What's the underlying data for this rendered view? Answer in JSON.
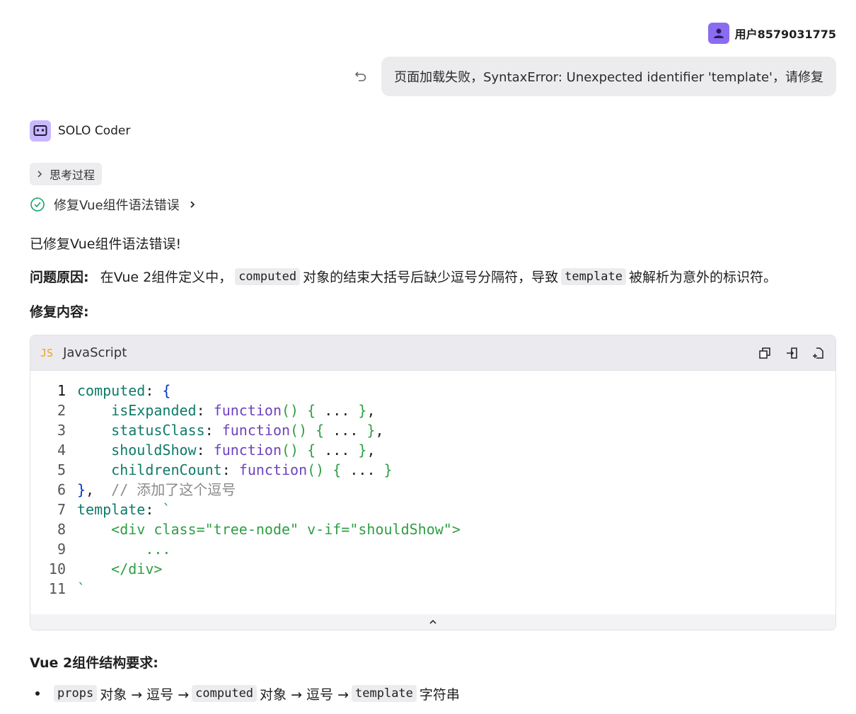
{
  "user": {
    "name": "用户8579031775",
    "message": "页面加载失败，SyntaxError: Unexpected identifier 'template'，请修复"
  },
  "agent": {
    "name": "SOLO Coder"
  },
  "thinking": {
    "label": "思考过程"
  },
  "task": {
    "label": "修复Vue组件语法错误"
  },
  "content": {
    "fixed": "已修复Vue组件语法错误!",
    "cause_label": "问题原因:",
    "cause_pre": "在Vue 2组件定义中，",
    "cause_code1": "computed",
    "cause_mid": "对象的结束大括号后缺少逗号分隔符，导致",
    "cause_code2": "template",
    "cause_post": "被解析为意外的标识符。",
    "fix_heading": "修复内容:",
    "structure_heading": "Vue 2组件结构要求:",
    "bullet_code1": "props",
    "bullet_t1": "对象 → 逗号 →",
    "bullet_code2": "computed",
    "bullet_t2": "对象 → 逗号 →",
    "bullet_code3": "template",
    "bullet_t3": "字符串"
  },
  "code": {
    "badge": "JS",
    "language": "JavaScript",
    "line_numbers": [
      "1",
      "2",
      "3",
      "4",
      "5",
      "6",
      "7",
      "8",
      "9",
      "10",
      "11"
    ],
    "tokens": {
      "computed": "computed",
      "isExpanded": "isExpanded",
      "statusClass": "statusClass",
      "shouldShow": "shouldShow",
      "childrenCount": "childrenCount",
      "function": "function",
      "comment": "// 添加了这个逗号",
      "template": "template",
      "line8": "<div class=\"tree-node\" v-if=\"shouldShow\">",
      "line9": "...",
      "line10": "</div>",
      "line11": "`"
    }
  }
}
